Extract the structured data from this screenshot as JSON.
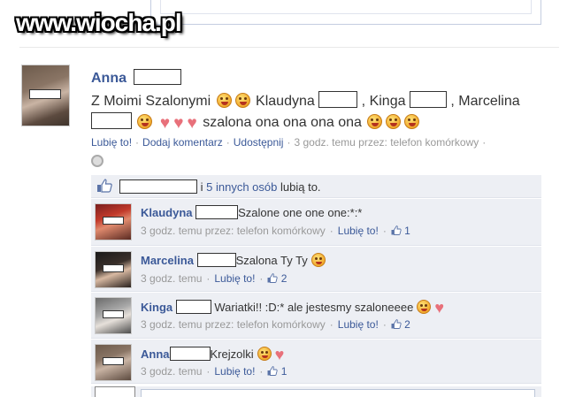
{
  "watermark": "www.wiocha.pl",
  "post": {
    "author": "Anna",
    "text_part1": "Z Moimi Szalonymi",
    "text_part2": "Klaudyna",
    "text_part3": ", Kinga",
    "text_part4": ", Marcelina",
    "text_part5": "szalona ona ona ona ona",
    "actions": {
      "like": "Lubię to!",
      "comment": "Dodaj komentarz",
      "share": "Udostępnij",
      "meta": "3 godz. temu przez: telefon komórkowy",
      "dot": "·"
    }
  },
  "likes": {
    "others_link": "5 innych osób",
    "suffix": "lubią to.",
    "prefix": "i"
  },
  "comments": [
    {
      "name": "Klaudyna",
      "text": "Szalone one one one:*:*",
      "meta": "3 godz. temu przez: telefon komórkowy",
      "like": "Lubię to!",
      "count": "1"
    },
    {
      "name": "Marcelina",
      "text": "Szalona Ty Ty",
      "meta": "3 godz. temu",
      "like": "Lubię to!",
      "count": "2"
    },
    {
      "name": "Kinga",
      "text": "Wariatki!! :D:* ale jestesmy szaloneeee",
      "meta": "3 godz. temu przez: telefon komórkowy",
      "like": "Lubię to!",
      "count": "2"
    },
    {
      "name": "Anna",
      "text": "Krejzolki",
      "meta": "3 godz. temu",
      "like": "Lubię to!",
      "count": "1"
    }
  ],
  "colors": {
    "link": "#3b5998",
    "comment_bg": "#edeff4",
    "muted": "#999999",
    "heart": "#e8707a"
  }
}
